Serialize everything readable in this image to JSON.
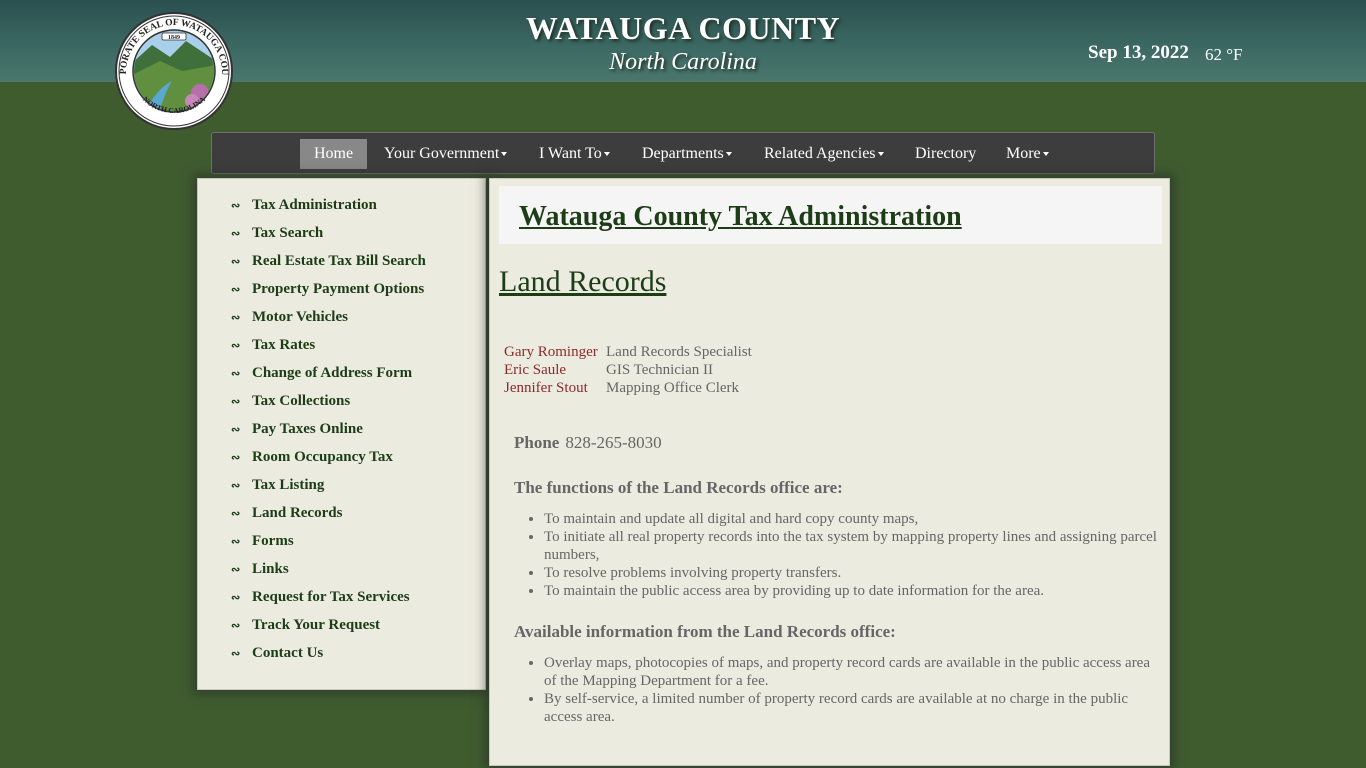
{
  "header": {
    "title": "WATAUGA COUNTY",
    "subtitle": "North Carolina",
    "date": "Sep 13, 2022",
    "temperature": "62 °F",
    "seal_text_top": "CORPORATE SEAL OF WATAUGA COUNTY",
    "seal_text_bottom": "NORTH CAROLINA",
    "seal_year": "1849"
  },
  "nav": {
    "items": [
      {
        "label": "Home",
        "active": true,
        "dropdown": false
      },
      {
        "label": "Your Government",
        "dropdown": true
      },
      {
        "label": "I Want To",
        "dropdown": true
      },
      {
        "label": "Departments",
        "dropdown": true
      },
      {
        "label": "Related Agencies",
        "dropdown": true
      },
      {
        "label": "Directory",
        "dropdown": false
      },
      {
        "label": "More",
        "dropdown": true
      }
    ]
  },
  "sidebar": {
    "icon": "leaf-icon",
    "items": [
      "Tax Administration",
      "Tax Search",
      "Real Estate Tax Bill Search",
      "Property Payment Options",
      "Motor Vehicles",
      "Tax Rates",
      "Change of Address Form",
      "Tax Collections",
      "Pay Taxes Online",
      "Room Occupancy Tax",
      "Tax Listing",
      "Land Records",
      "Forms",
      "Links",
      "Request for Tax Services",
      "Track Your Request",
      "Contact Us"
    ]
  },
  "main": {
    "page_title": "Watauga County Tax Administration",
    "section_title": "Land Records",
    "staff": [
      {
        "name": "Gary Rominger",
        "role": "Land Records Specialist"
      },
      {
        "name": "Eric Saule",
        "role": "GIS Technician II"
      },
      {
        "name": "Jennifer Stout",
        "role": "Mapping Office Clerk"
      }
    ],
    "phone_label": "Phone",
    "phone_number": "828-265-8030",
    "functions_heading": "The functions of the Land Records office are:",
    "functions": [
      "To maintain and update all digital and hard copy county maps,",
      "To initiate all real property records into the tax system by mapping property lines and assigning parcel numbers,",
      "To resolve problems involving property transfers.",
      "To maintain the public access area by providing up to date information for the area."
    ],
    "available_heading": "Available information from the Land Records office:",
    "available": [
      "Overlay maps, photocopies of maps, and property record cards are available in the public access area of the Mapping Department for a fee.",
      "By self-service, a limited number of property record cards are available at no charge in the public access area."
    ]
  },
  "colors": {
    "background": "#3f5c2f",
    "header_band": "#3d6a64",
    "navbar": "#3d3d3d",
    "nav_active": "#888888",
    "panel": "#ecebe0",
    "link_green": "#1d3d16",
    "staff_name": "#8b2b2b",
    "body_text": "#666666"
  }
}
